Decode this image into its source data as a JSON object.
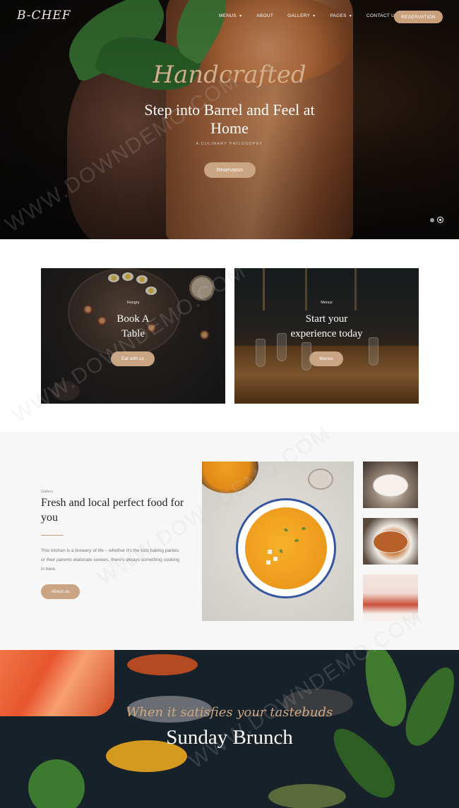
{
  "header": {
    "logo": "B-CHEF",
    "nav": [
      {
        "label": "MENUS",
        "dropdown": true
      },
      {
        "label": "ABOUT",
        "dropdown": false
      },
      {
        "label": "GALLERY",
        "dropdown": true
      },
      {
        "label": "PAGES",
        "dropdown": true
      },
      {
        "label": "CONTACT US",
        "dropdown": false
      }
    ],
    "reservation_button": "RESERVATION"
  },
  "hero": {
    "script": "Handcrafted",
    "title": "Step into Barrel and Feel at Home",
    "subtitle": "A CULINARY PHILOSOPHY",
    "button": "Reservation",
    "slides": 2,
    "active_slide": 2
  },
  "cards": [
    {
      "eyebrow": "Hungry",
      "title": "Book A Table",
      "button": "Eat with us"
    },
    {
      "eyebrow": "Menus",
      "title": "Start your experience today",
      "button": "Menus"
    }
  ],
  "about": {
    "eyebrow": "Gallery",
    "title": "Fresh and local perfect food for you",
    "text": "This kitchen is a brewery of life – whether it's the kids baking parties or their parents elaborate soirees, there's always something cooking in here.",
    "button": "About us"
  },
  "brunch": {
    "script": "When it satisfies your tastebuds",
    "title": "Sunday Brunch"
  },
  "watermark": "WWW.DOWNDEMO.COM",
  "colors": {
    "accent": "#c9a584",
    "hero_script": "#d2ae8c",
    "about_background": "#f7f7f7",
    "brunch_background": "#172129"
  }
}
